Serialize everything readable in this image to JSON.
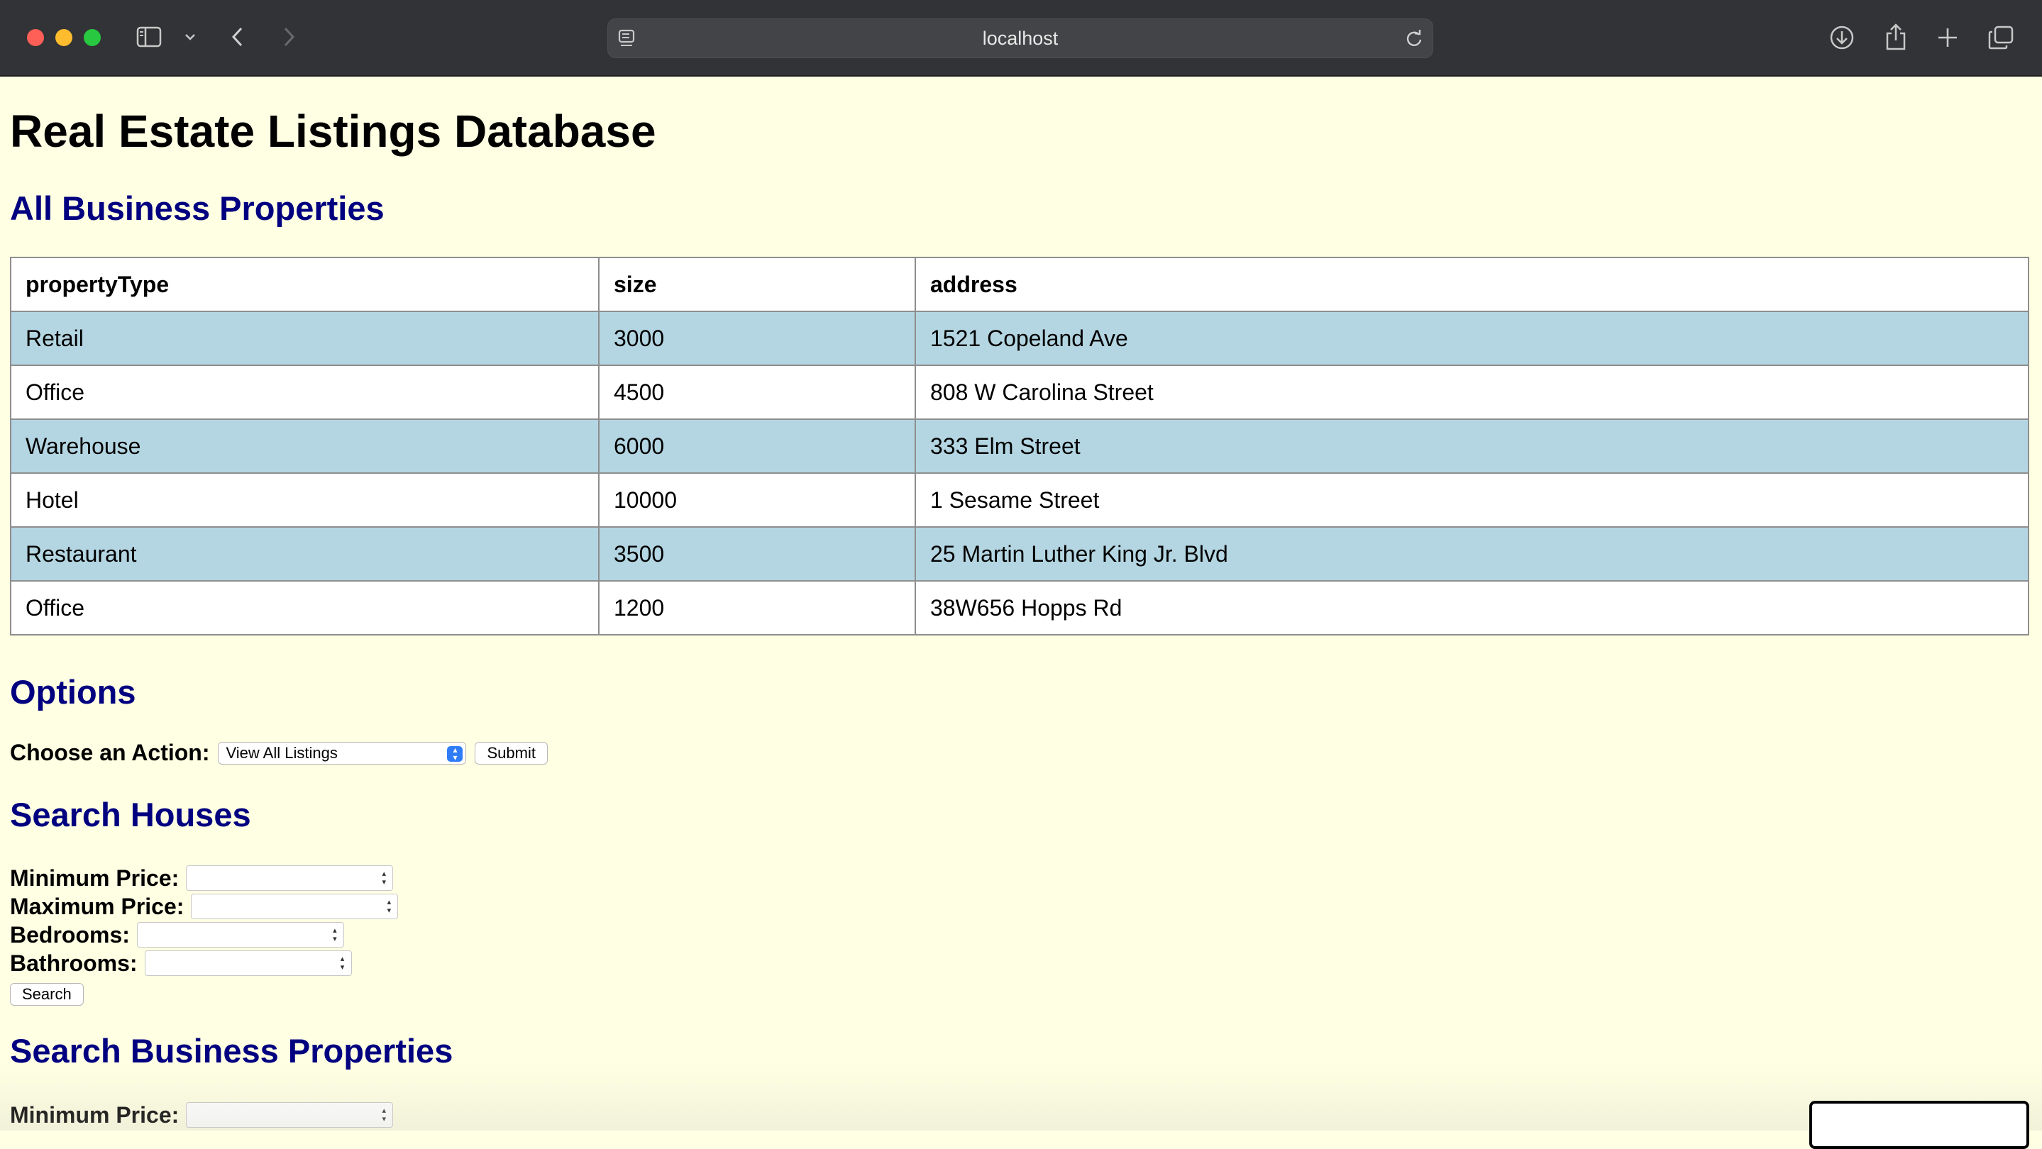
{
  "browser": {
    "url": "localhost"
  },
  "page": {
    "title": "Real Estate Listings Database",
    "business_heading": "All Business Properties",
    "table": {
      "headers": [
        "propertyType",
        "size",
        "address"
      ],
      "rows": [
        [
          "Retail",
          "3000",
          "1521 Copeland Ave"
        ],
        [
          "Office",
          "4500",
          "808 W Carolina Street"
        ],
        [
          "Warehouse",
          "6000",
          "333 Elm Street"
        ],
        [
          "Hotel",
          "10000",
          "1 Sesame Street"
        ],
        [
          "Restaurant",
          "3500",
          "25 Martin Luther King Jr. Blvd"
        ],
        [
          "Office",
          "1200",
          "38W656 Hopps Rd"
        ]
      ]
    },
    "options": {
      "heading": "Options",
      "label": "Choose an Action:",
      "selected": "View All Listings",
      "submit_label": "Submit"
    },
    "search_houses": {
      "heading": "Search Houses",
      "min_price_label": "Minimum Price:",
      "max_price_label": "Maximum Price:",
      "bedrooms_label": "Bedrooms:",
      "bathrooms_label": "Bathrooms:",
      "search_label": "Search"
    },
    "search_business": {
      "heading": "Search Business Properties",
      "min_price_label": "Minimum Price:"
    }
  },
  "colors": {
    "page_bg": "#ffffe3",
    "heading_blue": "#000080",
    "row_highlight": "#b4d6e2"
  }
}
